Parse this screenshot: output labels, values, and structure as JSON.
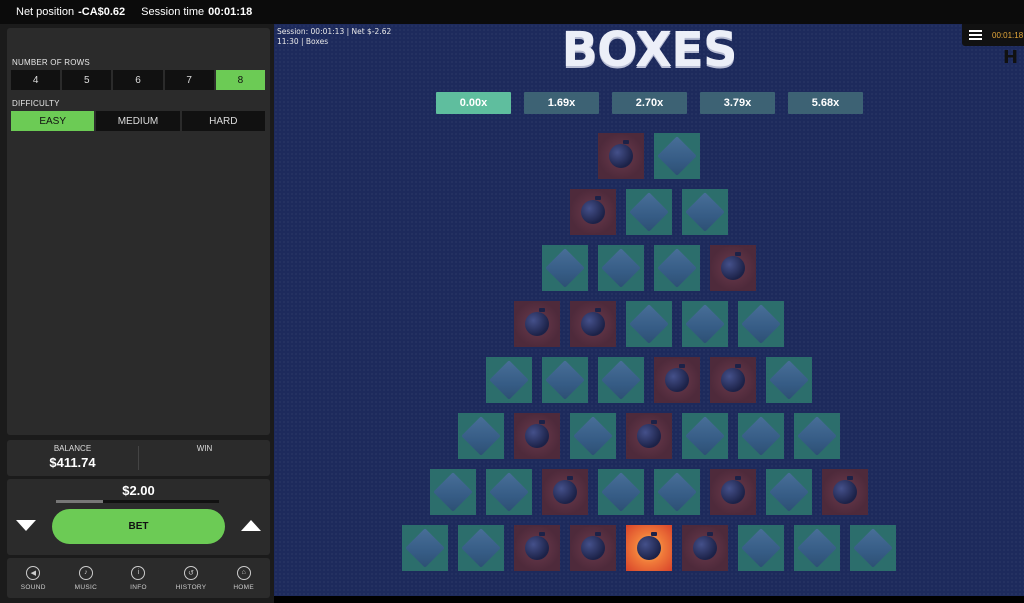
{
  "topbar": {
    "net_label": "Net position",
    "net_value": "-CA$0.62",
    "session_label": "Session time",
    "session_value": "00:01:18"
  },
  "settings": {
    "rows_label": "NUMBER OF ROWS",
    "rows_options": [
      "4",
      "5",
      "6",
      "7",
      "8"
    ],
    "rows_selected": "8",
    "difficulty_label": "DIFFICULTY",
    "difficulty_options": [
      "EASY",
      "MEDIUM",
      "HARD"
    ],
    "difficulty_selected": "EASY"
  },
  "balance": {
    "label": "BALANCE",
    "value": "$411.74",
    "win_label": "WIN",
    "win_value": ""
  },
  "bet": {
    "amount": "$2.00",
    "button_label": "BET",
    "slider_fraction": 0.29
  },
  "nav": [
    {
      "label": "SOUND",
      "icon": "speaker-icon"
    },
    {
      "label": "MUSIC",
      "icon": "music-note-icon"
    },
    {
      "label": "INFO",
      "icon": "info-icon"
    },
    {
      "label": "HISTORY",
      "icon": "history-icon"
    },
    {
      "label": "HOME",
      "icon": "home-icon"
    }
  ],
  "game": {
    "session_line1": "Session: 00:01:13 | Net  $-2.62",
    "session_line2": "11:30 | Boxes",
    "title": "BOXES",
    "hud_clock": "00:01:18",
    "hud_symbol": "H",
    "multipliers": [
      "0.00x",
      "1.69x",
      "2.70x",
      "3.79x",
      "5.68x"
    ],
    "active_multiplier": 0,
    "rows": [
      [
        "bomb",
        "gem"
      ],
      [
        "bomb",
        "gem",
        "gem"
      ],
      [
        "gem",
        "gem",
        "gem",
        "bomb"
      ],
      [
        "bomb",
        "bomb",
        "gem",
        "gem",
        "gem"
      ],
      [
        "gem",
        "gem",
        "gem",
        "bomb",
        "bomb",
        "gem"
      ],
      [
        "gem",
        "bomb",
        "gem",
        "bomb",
        "gem",
        "gem",
        "gem"
      ],
      [
        "gem",
        "gem",
        "bomb",
        "gem",
        "gem",
        "bomb",
        "gem",
        "bomb"
      ],
      [
        "gem",
        "gem",
        "bomb",
        "bomb",
        "hit",
        "bomb",
        "gem",
        "gem",
        "gem"
      ]
    ]
  }
}
